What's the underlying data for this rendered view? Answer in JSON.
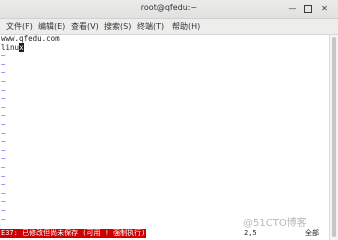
{
  "window": {
    "title": "root@qfedu:~",
    "controls": {
      "minimize_icon": "minimize-icon",
      "maximize_icon": "maximize-icon",
      "close_icon": "close-icon"
    }
  },
  "menu": {
    "items": [
      {
        "label": "文件(F)"
      },
      {
        "label": "编辑(E)"
      },
      {
        "label": "查看(V)"
      },
      {
        "label": "搜索(S)"
      },
      {
        "label": "终端(T)"
      },
      {
        "label": "帮助(H)"
      }
    ]
  },
  "terminal": {
    "lines": [
      "www.qfedu.com",
      "linu"
    ],
    "cursor_char": "x",
    "tilde": "~",
    "tilde_color": "#5a5aff"
  },
  "statusline": {
    "error": "E37: 已修改但尚未保存 (可用 ! 强制执行)",
    "position": "2,5",
    "scope": "全部",
    "error_bg": "#cc0000"
  },
  "watermark": "@51CTO博客"
}
